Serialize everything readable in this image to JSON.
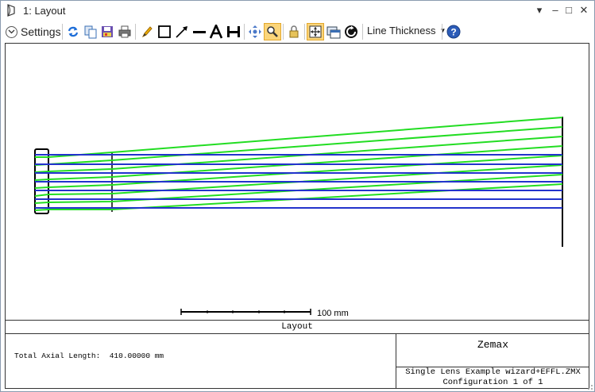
{
  "window": {
    "title": "1: Layout",
    "controls": {
      "minimize": "–",
      "maximize": "□",
      "close": "✕",
      "menu": "▾"
    }
  },
  "toolbar": {
    "settings_label": "Settings",
    "line_thickness_label": "Line Thickness",
    "icons": [
      "refresh-icon",
      "copy-icon",
      "save-icon",
      "print-icon",
      "pencil-icon",
      "rectangle-icon",
      "arrow-line-icon",
      "line-icon",
      "text-icon",
      "dimension-icon",
      "pan-icon",
      "zoom-icon",
      "lock-icon",
      "fit-icon",
      "window-icon",
      "rotate-icon",
      "help-icon"
    ]
  },
  "plot": {
    "scale_bar_label": "100 mm",
    "caption": "Layout",
    "total_axial_length": "Total Axial Length:  410.00000 mm",
    "brand": "Zemax",
    "file_name": "Single Lens Example wizard+EFFL.ZMX",
    "configuration": "Configuration 1 of 1",
    "colors": {
      "field1_rays": "#2233cc",
      "field2_rays": "#22dd22",
      "outline": "#000000"
    }
  }
}
